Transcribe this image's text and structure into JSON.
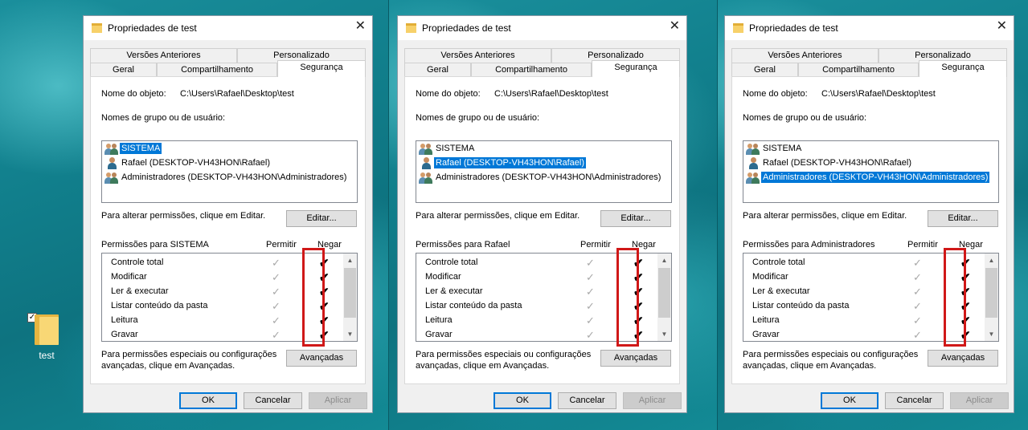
{
  "desktop": {
    "icon_label": "test",
    "icon_checkbox": "✓"
  },
  "dialogs": [
    {
      "title": "Propriedades de test",
      "tabs_top": [
        "Versões Anteriores",
        "Personalizado"
      ],
      "tabs_bottom": [
        "Geral",
        "Compartilhamento",
        "Segurança"
      ],
      "active_tab": "Segurança",
      "object_label": "Nome do objeto:",
      "object_value": "C:\\Users\\Rafael\\Desktop\\test",
      "groups_label": "Nomes de grupo ou de usuário:",
      "users": [
        {
          "name": "SISTEMA",
          "icon": "group-icon",
          "selected": true
        },
        {
          "name": "Rafael (DESKTOP-VH43HON\\Rafael)",
          "icon": "user-icon",
          "selected": false
        },
        {
          "name": "Administradores (DESKTOP-VH43HON\\Administradores)",
          "icon": "group-icon",
          "selected": false
        }
      ],
      "change_text": "Para alterar permissões, clique em Editar.",
      "edit_button": "Editar...",
      "perm_label": "Permissões para SISTEMA",
      "allow_header": "Permitir",
      "deny_header": "Negar",
      "permissions": [
        "Controle total",
        "Modificar",
        "Ler & executar",
        "Listar conteúdo da pasta",
        "Leitura",
        "Gravar"
      ],
      "allow_mark": "✓",
      "deny_mark": "✔",
      "advanced_text_1": "Para permissões especiais ou configurações",
      "advanced_text_2": "avançadas, clique em Avançadas.",
      "advanced_button": "Avançadas",
      "ok_button": "OK",
      "cancel_button": "Cancelar",
      "apply_button": "Aplicar",
      "close_glyph": "✕",
      "scroll_up": "▲",
      "scroll_down": "▼"
    },
    {
      "title": "Propriedades de test",
      "tabs_top": [
        "Versões Anteriores",
        "Personalizado"
      ],
      "tabs_bottom": [
        "Geral",
        "Compartilhamento",
        "Segurança"
      ],
      "active_tab": "Segurança",
      "object_label": "Nome do objeto:",
      "object_value": "C:\\Users\\Rafael\\Desktop\\test",
      "groups_label": "Nomes de grupo ou de usuário:",
      "users": [
        {
          "name": "SISTEMA",
          "icon": "group-icon",
          "selected": false
        },
        {
          "name": "Rafael (DESKTOP-VH43HON\\Rafael)",
          "icon": "user-icon",
          "selected": true
        },
        {
          "name": "Administradores (DESKTOP-VH43HON\\Administradores)",
          "icon": "group-icon",
          "selected": false
        }
      ],
      "change_text": "Para alterar permissões, clique em Editar.",
      "edit_button": "Editar...",
      "perm_label": "Permissões para Rafael",
      "allow_header": "Permitir",
      "deny_header": "Negar",
      "permissions": [
        "Controle total",
        "Modificar",
        "Ler & executar",
        "Listar conteúdo da pasta",
        "Leitura",
        "Gravar"
      ],
      "allow_mark": "✓",
      "deny_mark": "✔",
      "advanced_text_1": "Para permissões especiais ou configurações",
      "advanced_text_2": "avançadas, clique em Avançadas.",
      "advanced_button": "Avançadas",
      "ok_button": "OK",
      "cancel_button": "Cancelar",
      "apply_button": "Aplicar",
      "close_glyph": "✕",
      "scroll_up": "▲",
      "scroll_down": "▼"
    },
    {
      "title": "Propriedades de test",
      "tabs_top": [
        "Versões Anteriores",
        "Personalizado"
      ],
      "tabs_bottom": [
        "Geral",
        "Compartilhamento",
        "Segurança"
      ],
      "active_tab": "Segurança",
      "object_label": "Nome do objeto:",
      "object_value": "C:\\Users\\Rafael\\Desktop\\test",
      "groups_label": "Nomes de grupo ou de usuário:",
      "users": [
        {
          "name": "SISTEMA",
          "icon": "group-icon",
          "selected": false
        },
        {
          "name": "Rafael (DESKTOP-VH43HON\\Rafael)",
          "icon": "user-icon",
          "selected": false
        },
        {
          "name": "Administradores (DESKTOP-VH43HON\\Administradores)",
          "icon": "group-icon",
          "selected": true
        }
      ],
      "change_text": "Para alterar permissões, clique em Editar.",
      "edit_button": "Editar...",
      "perm_label": "Permissões para Administradores",
      "allow_header": "Permitir",
      "deny_header": "Negar",
      "permissions": [
        "Controle total",
        "Modificar",
        "Ler & executar",
        "Listar conteúdo da pasta",
        "Leitura",
        "Gravar"
      ],
      "allow_mark": "✓",
      "deny_mark": "✔",
      "advanced_text_1": "Para permissões especiais ou configurações",
      "advanced_text_2": "avançadas, clique em Avançadas.",
      "advanced_button": "Avançadas",
      "ok_button": "OK",
      "cancel_button": "Cancelar",
      "apply_button": "Aplicar",
      "close_glyph": "✕",
      "scroll_up": "▲",
      "scroll_down": "▼"
    }
  ],
  "colors": {
    "selection": "#0078d7",
    "highlight_box": "#d01818",
    "desktop": "#117f8c"
  }
}
